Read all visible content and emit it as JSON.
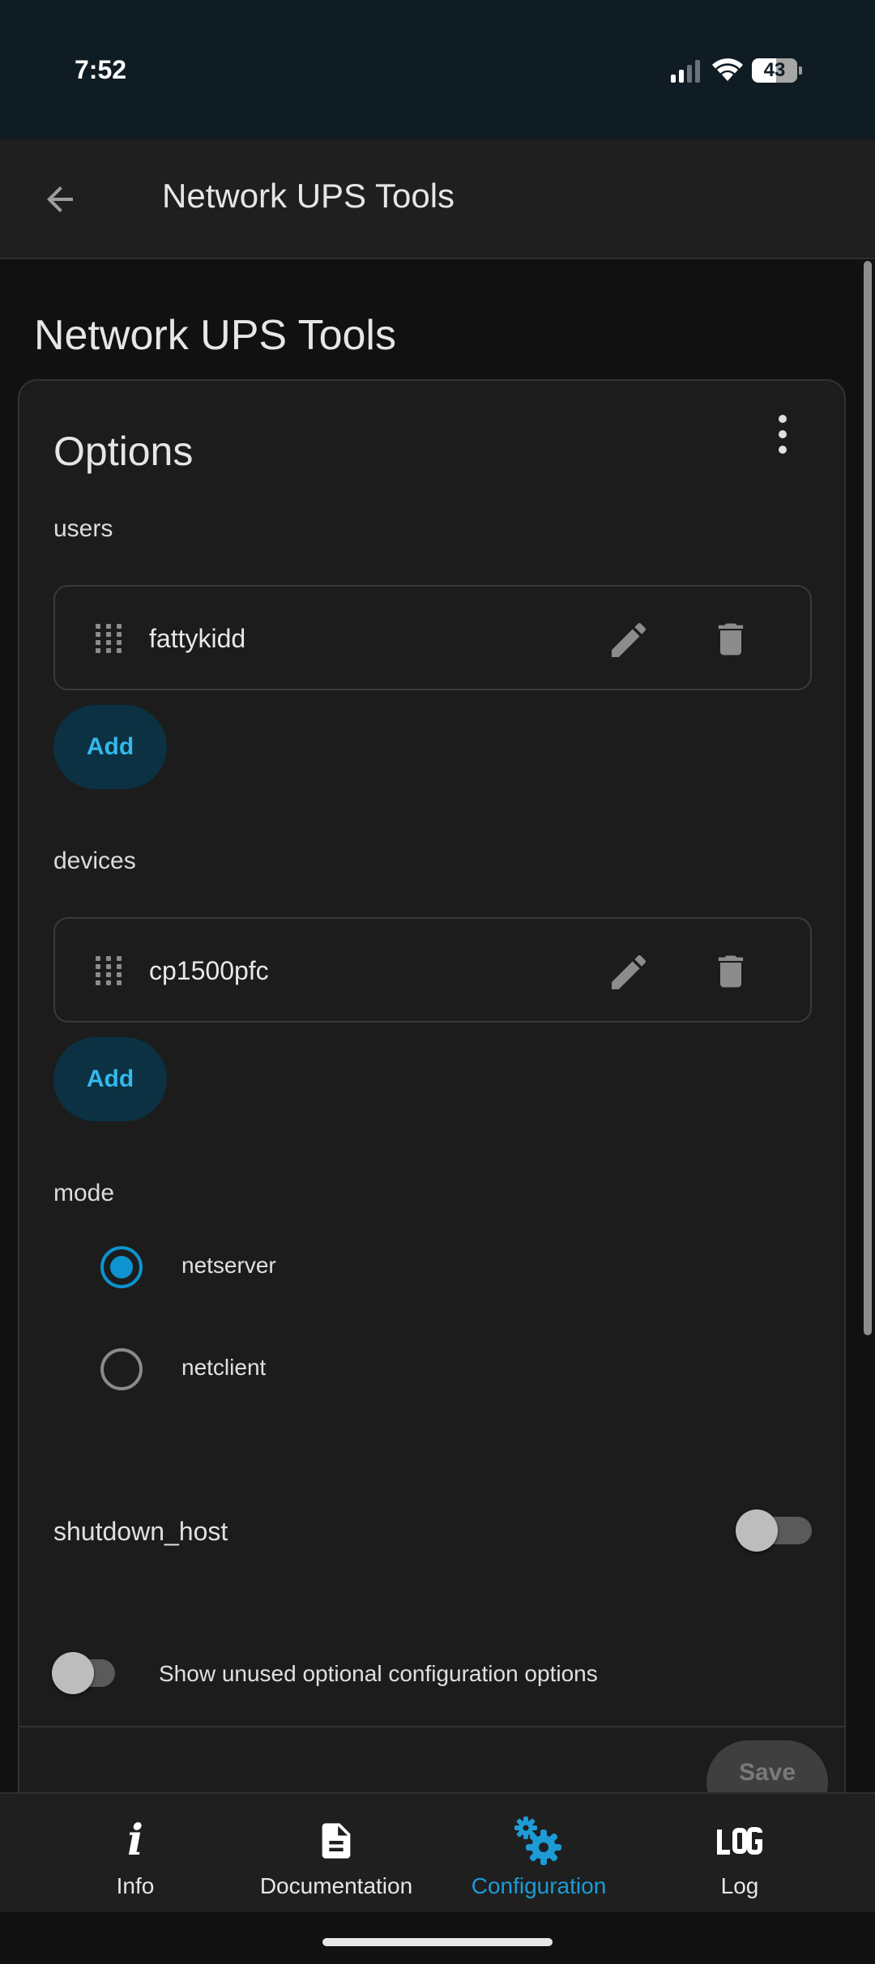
{
  "status_bar": {
    "time": "7:52",
    "battery": "43"
  },
  "app_bar": {
    "title": "Network UPS Tools"
  },
  "page": {
    "title": "Network UPS Tools"
  },
  "options": {
    "title": "Options",
    "users": {
      "label": "users",
      "items": [
        "fattykidd"
      ],
      "add_label": "Add"
    },
    "devices": {
      "label": "devices",
      "items": [
        "cp1500pfc"
      ],
      "add_label": "Add"
    },
    "mode": {
      "label": "mode",
      "options": [
        "netserver",
        "netclient"
      ],
      "selected": "netserver"
    },
    "shutdown_host": {
      "label": "shutdown_host",
      "enabled": false
    },
    "show_unused": {
      "label": "Show unused optional configuration options",
      "enabled": false
    },
    "save_label": "Save"
  },
  "bottom_nav": {
    "items": [
      {
        "label": "Info",
        "icon": "info-icon"
      },
      {
        "label": "Documentation",
        "icon": "document-icon"
      },
      {
        "label": "Configuration",
        "icon": "cogs-icon"
      },
      {
        "label": "Log",
        "icon": "log-icon"
      }
    ],
    "active": "Configuration",
    "accent": "#1d9bd6"
  }
}
